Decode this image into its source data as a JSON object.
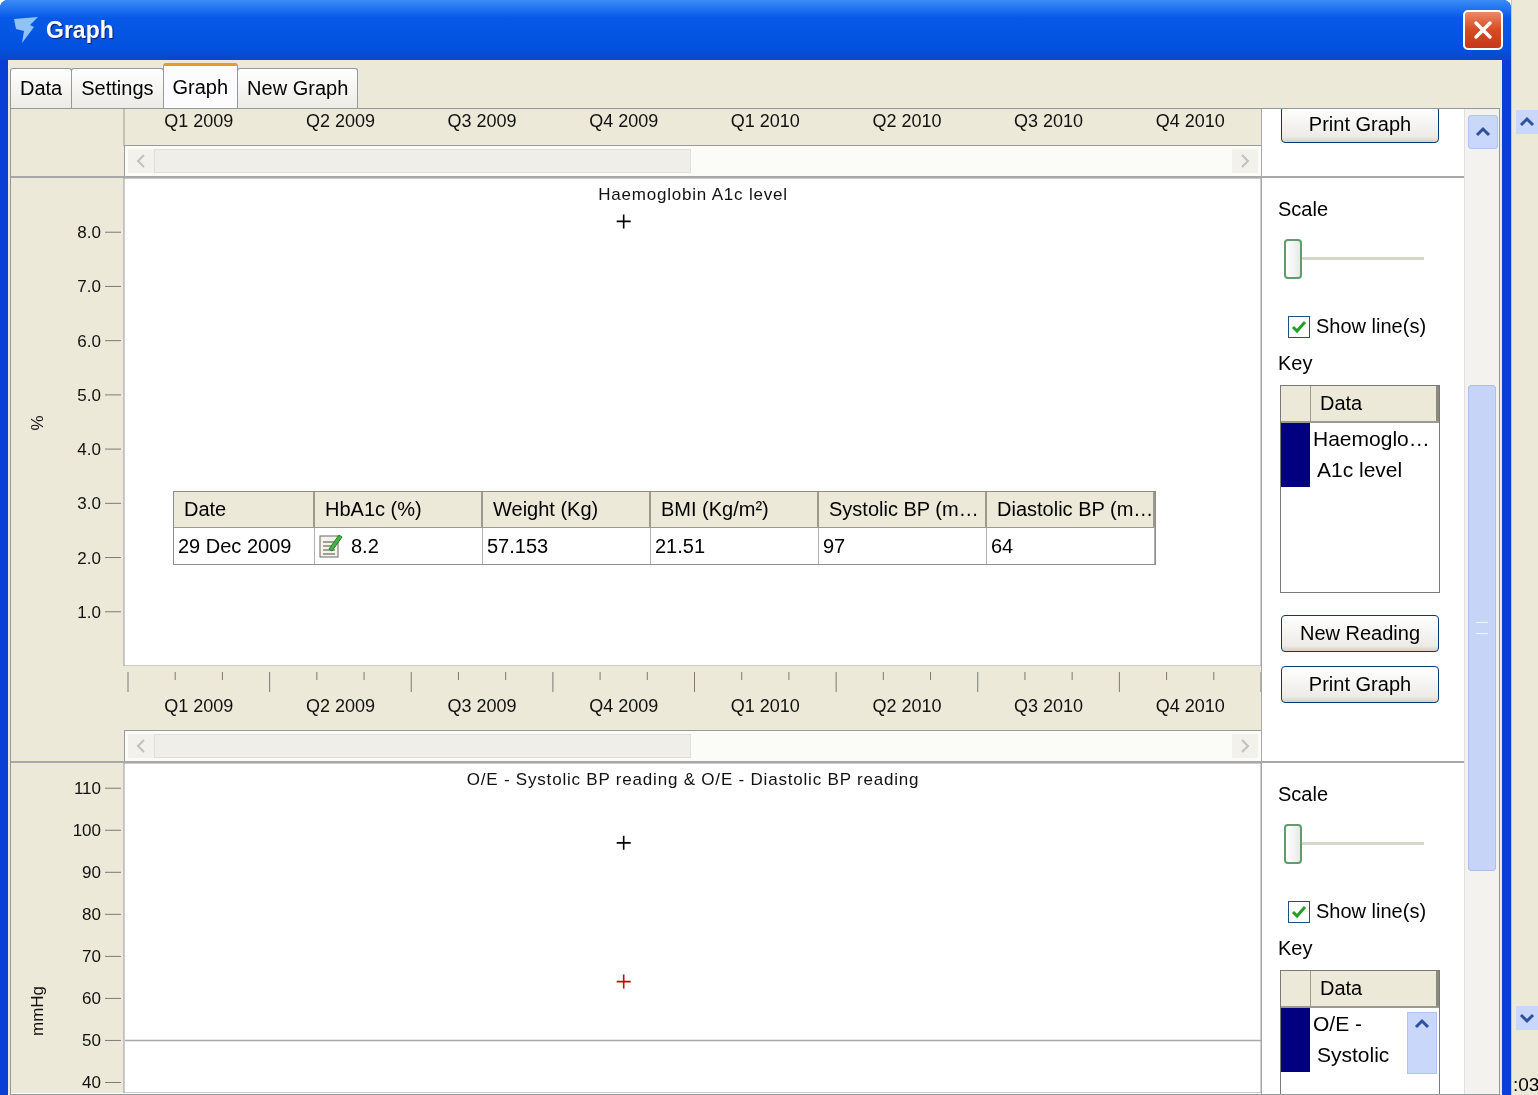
{
  "window": {
    "title": "Graph"
  },
  "tabs": [
    {
      "label": "Data",
      "selected": false
    },
    {
      "label": "Settings",
      "selected": false
    },
    {
      "label": "Graph",
      "selected": true
    },
    {
      "label": "New Graph",
      "selected": false
    }
  ],
  "previous_panel": {
    "x_axis_labels": [
      "Q1 2009",
      "Q2 2009",
      "Q3 2009",
      "Q4 2009",
      "Q1 2010",
      "Q2 2010",
      "Q3 2010",
      "Q4 2010"
    ],
    "buttons": [
      "Print Graph"
    ]
  },
  "panels": [
    {
      "chart_data": {
        "type": "scatter",
        "title": "Haemoglobin A1c level",
        "ylabel": "%",
        "ylim": [
          0,
          9
        ],
        "categories": [
          "Q1 2009",
          "Q2 2009",
          "Q3 2009",
          "Q4 2009",
          "Q1 2010",
          "Q2 2010",
          "Q3 2010",
          "Q4 2010"
        ],
        "yticks": [
          {
            "value": 1,
            "label": "1.0"
          },
          {
            "value": 2,
            "label": "2.0"
          },
          {
            "value": 3,
            "label": "3.0"
          },
          {
            "value": 4,
            "label": "4.0"
          },
          {
            "value": 5,
            "label": "5.0"
          },
          {
            "value": 6,
            "label": "6.0"
          },
          {
            "value": 7,
            "label": "7.0"
          },
          {
            "value": 8,
            "label": "8.0"
          }
        ],
        "series": [
          {
            "color": "#000000",
            "values": [
              null,
              null,
              null,
              8.2,
              null,
              null,
              null,
              null
            ]
          }
        ]
      },
      "scale": {
        "label": "Scale",
        "level": 0
      },
      "show_lines": {
        "label": "Show line(s)",
        "checked": true
      },
      "key": {
        "label": "Key",
        "header": "Data",
        "entries": [
          {
            "lines": [
              "Haemoglo…",
              "A1c level"
            ],
            "color": "#000080"
          }
        ]
      },
      "buttons": [
        "New Reading",
        "Print Graph"
      ],
      "reading_popup": {
        "columns": [
          "Date",
          "HbA1c (%)",
          "Weight (Kg)",
          "BMI (Kg/m²)",
          "Systolic BP (m…",
          "Diastolic BP (m…"
        ],
        "rows": [
          [
            {
              "kind": "plain",
              "text": "29 Dec 2009"
            },
            {
              "kind": "note",
              "text": "8.2"
            },
            {
              "kind": "plain",
              "text": "57.153"
            },
            {
              "kind": "plain",
              "text": "21.51"
            },
            {
              "kind": "plain",
              "text": "97"
            },
            {
              "kind": "plain",
              "text": "64"
            }
          ]
        ]
      }
    },
    {
      "chart_data": {
        "type": "scatter",
        "title": "O/E - Systolic BP reading & O/E - Diastolic BP reading",
        "ylabel": "mmHg",
        "ylim": [
          37.5,
          116
        ],
        "categories": [
          null,
          null,
          null,
          null,
          null,
          null,
          null,
          null
        ],
        "yticks": [
          {
            "value": 40,
            "label": "40"
          },
          {
            "value": 50,
            "label": "50"
          },
          {
            "value": 60,
            "label": "60"
          },
          {
            "value": 70,
            "label": "70"
          },
          {
            "value": 80,
            "label": "80"
          },
          {
            "value": 90,
            "label": "90"
          },
          {
            "value": 100,
            "label": "100"
          },
          {
            "value": 110,
            "label": "110"
          }
        ],
        "series": [
          {
            "color": "#000000",
            "values": [
              null,
              null,
              null,
              97,
              null,
              null,
              null,
              null
            ]
          },
          {
            "color": "#cc0000",
            "values": [
              null,
              null,
              null,
              64,
              null,
              null,
              null,
              null
            ]
          }
        ],
        "ref_lines": [
          {
            "axis": "y",
            "value": 50
          }
        ]
      },
      "scale": {
        "label": "Scale",
        "level": 0
      },
      "show_lines": {
        "label": "Show line(s)",
        "checked": true
      },
      "key": {
        "label": "Key",
        "header": "Data",
        "scrollbar": true,
        "entries": [
          {
            "lines": [
              "O/E -",
              "Systolic"
            ],
            "color": "#000080"
          }
        ]
      }
    }
  ],
  "background_window": {
    "text": ":03"
  }
}
